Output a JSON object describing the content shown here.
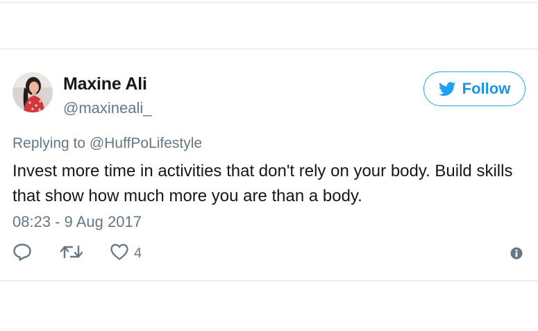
{
  "tweet": {
    "author_name": "Maxine Ali",
    "author_handle": "@maxineali_",
    "follow_label": "Follow",
    "replying_prefix": "Replying to ",
    "replying_to": "@HuffPoLifestyle",
    "text": "Invest more time in activities that don't rely on your body. Build skills that show how much more you are than a body.",
    "timestamp": "08:23 - 9 Aug 2017",
    "like_count": "4"
  },
  "icons": {
    "follow": "twitter-bird-icon",
    "reply": "reply-icon",
    "retweet": "retweet-icon",
    "like": "heart-icon",
    "info": "info-icon"
  },
  "colors": {
    "accent": "#1da1f2",
    "follow_text": "#1b95e0",
    "primary_text": "#14171a",
    "secondary_text": "#657786",
    "divider": "#e1e8ed"
  }
}
